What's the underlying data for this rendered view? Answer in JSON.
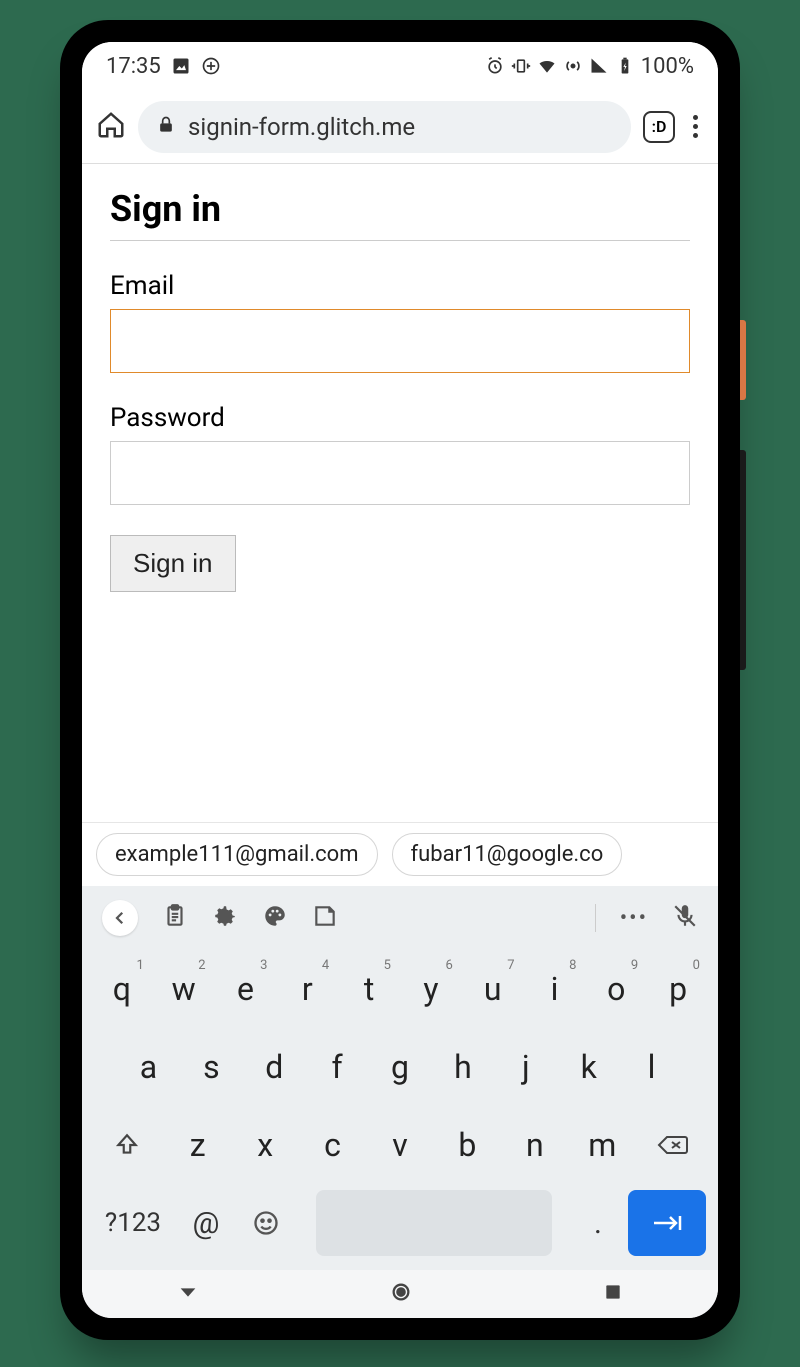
{
  "status": {
    "time": "17:35",
    "battery": "100%"
  },
  "browser": {
    "url": "signin-form.glitch.me",
    "tab_badge": ":D"
  },
  "page": {
    "title": "Sign in",
    "email_label": "Email",
    "email_value": "",
    "password_label": "Password",
    "password_value": "",
    "signin_button": "Sign in"
  },
  "suggestions": [
    "example111@gmail.com",
    "fubar11@google.co"
  ],
  "keyboard": {
    "row1": [
      {
        "k": "q",
        "s": "1"
      },
      {
        "k": "w",
        "s": "2"
      },
      {
        "k": "e",
        "s": "3"
      },
      {
        "k": "r",
        "s": "4"
      },
      {
        "k": "t",
        "s": "5"
      },
      {
        "k": "y",
        "s": "6"
      },
      {
        "k": "u",
        "s": "7"
      },
      {
        "k": "i",
        "s": "8"
      },
      {
        "k": "o",
        "s": "9"
      },
      {
        "k": "p",
        "s": "0"
      }
    ],
    "row2": [
      "a",
      "s",
      "d",
      "f",
      "g",
      "h",
      "j",
      "k",
      "l"
    ],
    "row3": [
      "z",
      "x",
      "c",
      "v",
      "b",
      "n",
      "m"
    ],
    "symbols_label": "?123",
    "at": "@",
    "dot": "."
  }
}
